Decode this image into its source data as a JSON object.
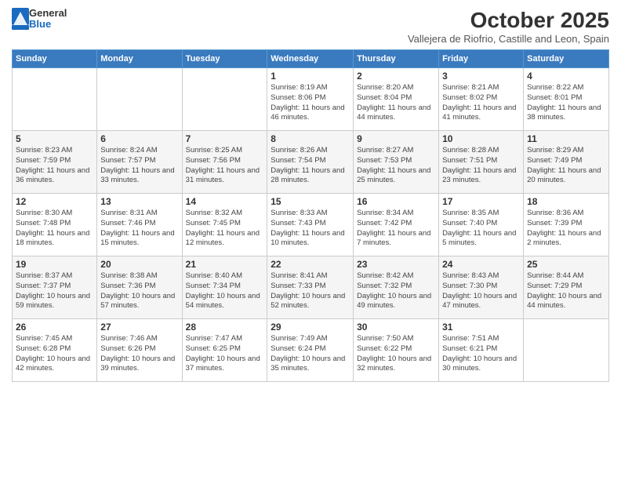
{
  "logo": {
    "general": "General",
    "blue": "Blue"
  },
  "title": "October 2025",
  "subtitle": "Vallejera de Riofrio, Castille and Leon, Spain",
  "days_of_week": [
    "Sunday",
    "Monday",
    "Tuesday",
    "Wednesday",
    "Thursday",
    "Friday",
    "Saturday"
  ],
  "weeks": [
    [
      {
        "day": "",
        "info": ""
      },
      {
        "day": "",
        "info": ""
      },
      {
        "day": "",
        "info": ""
      },
      {
        "day": "1",
        "info": "Sunrise: 8:19 AM\nSunset: 8:06 PM\nDaylight: 11 hours and 46 minutes."
      },
      {
        "day": "2",
        "info": "Sunrise: 8:20 AM\nSunset: 8:04 PM\nDaylight: 11 hours and 44 minutes."
      },
      {
        "day": "3",
        "info": "Sunrise: 8:21 AM\nSunset: 8:02 PM\nDaylight: 11 hours and 41 minutes."
      },
      {
        "day": "4",
        "info": "Sunrise: 8:22 AM\nSunset: 8:01 PM\nDaylight: 11 hours and 38 minutes."
      }
    ],
    [
      {
        "day": "5",
        "info": "Sunrise: 8:23 AM\nSunset: 7:59 PM\nDaylight: 11 hours and 36 minutes."
      },
      {
        "day": "6",
        "info": "Sunrise: 8:24 AM\nSunset: 7:57 PM\nDaylight: 11 hours and 33 minutes."
      },
      {
        "day": "7",
        "info": "Sunrise: 8:25 AM\nSunset: 7:56 PM\nDaylight: 11 hours and 31 minutes."
      },
      {
        "day": "8",
        "info": "Sunrise: 8:26 AM\nSunset: 7:54 PM\nDaylight: 11 hours and 28 minutes."
      },
      {
        "day": "9",
        "info": "Sunrise: 8:27 AM\nSunset: 7:53 PM\nDaylight: 11 hours and 25 minutes."
      },
      {
        "day": "10",
        "info": "Sunrise: 8:28 AM\nSunset: 7:51 PM\nDaylight: 11 hours and 23 minutes."
      },
      {
        "day": "11",
        "info": "Sunrise: 8:29 AM\nSunset: 7:49 PM\nDaylight: 11 hours and 20 minutes."
      }
    ],
    [
      {
        "day": "12",
        "info": "Sunrise: 8:30 AM\nSunset: 7:48 PM\nDaylight: 11 hours and 18 minutes."
      },
      {
        "day": "13",
        "info": "Sunrise: 8:31 AM\nSunset: 7:46 PM\nDaylight: 11 hours and 15 minutes."
      },
      {
        "day": "14",
        "info": "Sunrise: 8:32 AM\nSunset: 7:45 PM\nDaylight: 11 hours and 12 minutes."
      },
      {
        "day": "15",
        "info": "Sunrise: 8:33 AM\nSunset: 7:43 PM\nDaylight: 11 hours and 10 minutes."
      },
      {
        "day": "16",
        "info": "Sunrise: 8:34 AM\nSunset: 7:42 PM\nDaylight: 11 hours and 7 minutes."
      },
      {
        "day": "17",
        "info": "Sunrise: 8:35 AM\nSunset: 7:40 PM\nDaylight: 11 hours and 5 minutes."
      },
      {
        "day": "18",
        "info": "Sunrise: 8:36 AM\nSunset: 7:39 PM\nDaylight: 11 hours and 2 minutes."
      }
    ],
    [
      {
        "day": "19",
        "info": "Sunrise: 8:37 AM\nSunset: 7:37 PM\nDaylight: 10 hours and 59 minutes."
      },
      {
        "day": "20",
        "info": "Sunrise: 8:38 AM\nSunset: 7:36 PM\nDaylight: 10 hours and 57 minutes."
      },
      {
        "day": "21",
        "info": "Sunrise: 8:40 AM\nSunset: 7:34 PM\nDaylight: 10 hours and 54 minutes."
      },
      {
        "day": "22",
        "info": "Sunrise: 8:41 AM\nSunset: 7:33 PM\nDaylight: 10 hours and 52 minutes."
      },
      {
        "day": "23",
        "info": "Sunrise: 8:42 AM\nSunset: 7:32 PM\nDaylight: 10 hours and 49 minutes."
      },
      {
        "day": "24",
        "info": "Sunrise: 8:43 AM\nSunset: 7:30 PM\nDaylight: 10 hours and 47 minutes."
      },
      {
        "day": "25",
        "info": "Sunrise: 8:44 AM\nSunset: 7:29 PM\nDaylight: 10 hours and 44 minutes."
      }
    ],
    [
      {
        "day": "26",
        "info": "Sunrise: 7:45 AM\nSunset: 6:28 PM\nDaylight: 10 hours and 42 minutes."
      },
      {
        "day": "27",
        "info": "Sunrise: 7:46 AM\nSunset: 6:26 PM\nDaylight: 10 hours and 39 minutes."
      },
      {
        "day": "28",
        "info": "Sunrise: 7:47 AM\nSunset: 6:25 PM\nDaylight: 10 hours and 37 minutes."
      },
      {
        "day": "29",
        "info": "Sunrise: 7:49 AM\nSunset: 6:24 PM\nDaylight: 10 hours and 35 minutes."
      },
      {
        "day": "30",
        "info": "Sunrise: 7:50 AM\nSunset: 6:22 PM\nDaylight: 10 hours and 32 minutes."
      },
      {
        "day": "31",
        "info": "Sunrise: 7:51 AM\nSunset: 6:21 PM\nDaylight: 10 hours and 30 minutes."
      },
      {
        "day": "",
        "info": ""
      }
    ]
  ]
}
